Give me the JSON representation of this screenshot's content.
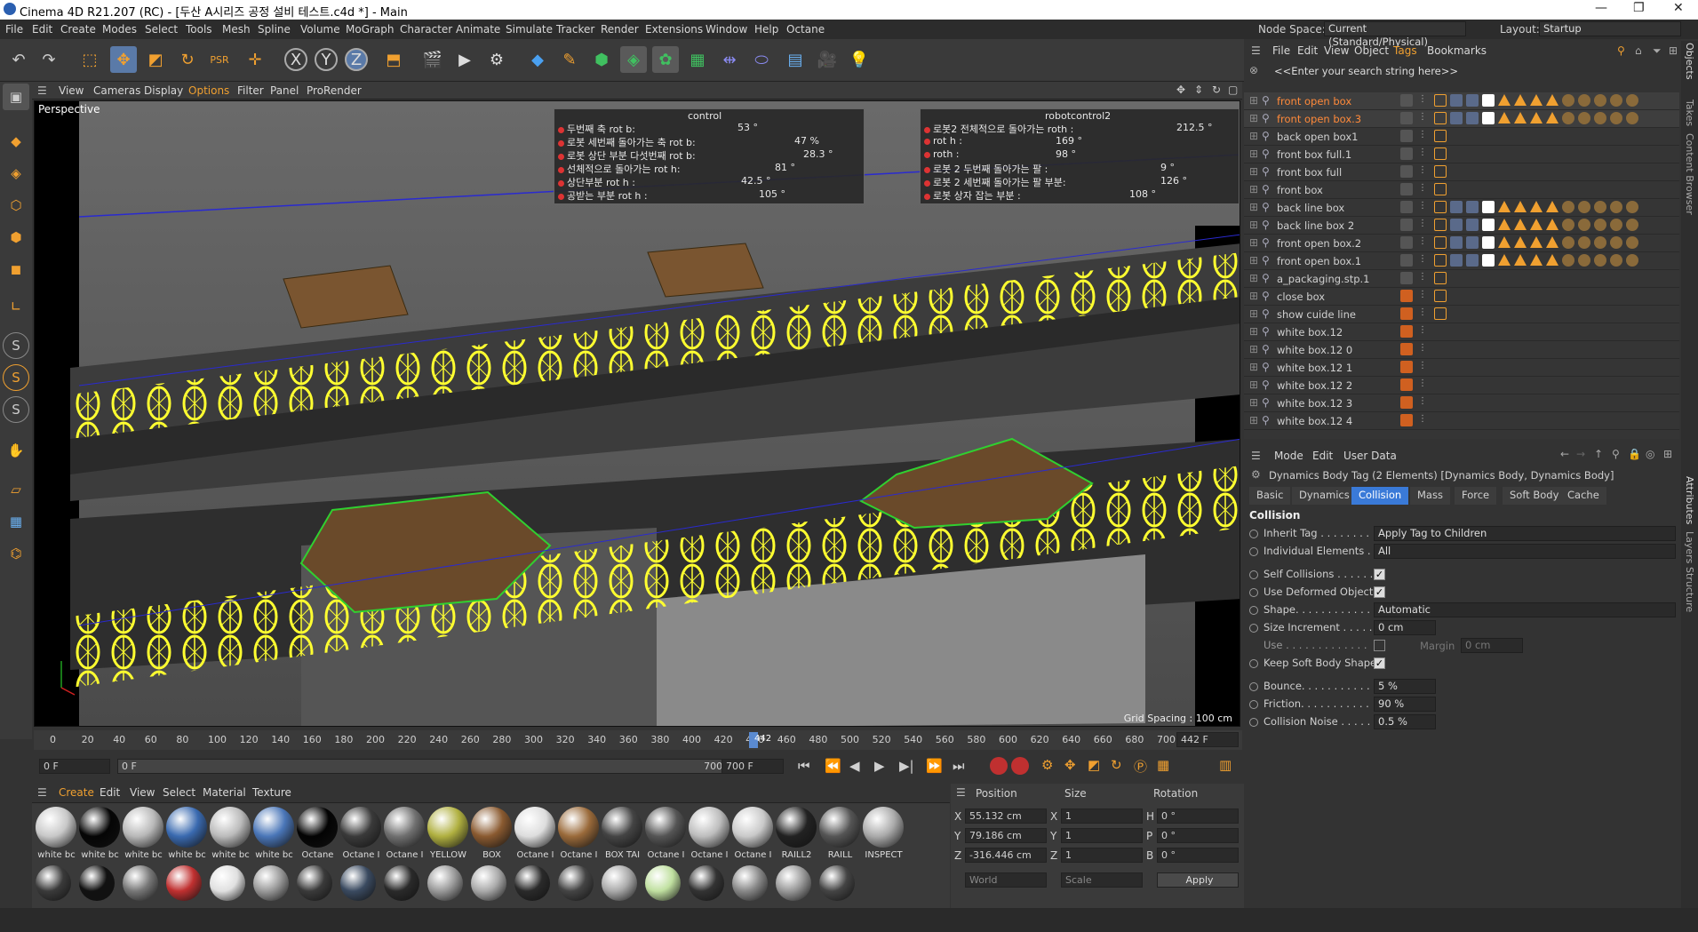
{
  "title": "Cinema 4D R21.207 (RC) - [두산 A시리즈 공정 설비 테스트.c4d *] - Main",
  "menu": [
    "File",
    "Edit",
    "Create",
    "Modes",
    "Select",
    "Tools",
    "Mesh",
    "Spline",
    "Volume",
    "MoGraph",
    "Character",
    "Animate",
    "Simulate",
    "Tracker",
    "Render",
    "Extensions",
    "Window",
    "Help",
    "Octane"
  ],
  "right_header": {
    "node_space_label": "Node Space:",
    "node_space_value": "Current (Standard/Physical)",
    "layout_label": "Layout:",
    "layout_value": "Startup"
  },
  "viewport": {
    "menu": [
      "View",
      "Cameras",
      "Display",
      "Options",
      "Filter",
      "Panel",
      "ProRender"
    ],
    "label": "Perspective",
    "grid_spacing": "Grid Spacing : 100 cm"
  },
  "control_panel": {
    "title": "control",
    "rows": [
      {
        "label": "두번째 축 rot b:",
        "value": "53 °"
      },
      {
        "label": "로봇 세번째 돌아가는 축  rot b:",
        "value": "47 %"
      },
      {
        "label": "로봇 상단 부분 다섯번째 rot b:",
        "value": "28.3 °"
      },
      {
        "label": "선체적으로 돌아가는 rot h:",
        "value": "81 °"
      },
      {
        "label": "상단부분  rot h :",
        "value": "42.5 °"
      },
      {
        "label": "공받는 부분  rot h :",
        "value": "105 °"
      }
    ]
  },
  "robot_panel": {
    "title": "robotcontrol2",
    "rows": [
      {
        "label": "로봇2 전체적으로 돌아가는 roth :",
        "value": "212.5 °"
      },
      {
        "label": "rot h :",
        "value": "169 °"
      },
      {
        "label": "roth :",
        "value": "98 °"
      },
      {
        "label": "로봇 2 두번째 돌아가는 팔 :",
        "value": "9 °"
      },
      {
        "label": "로봇 2 세번째 돌아가는 팔 부분:",
        "value": "126 °"
      },
      {
        "label": "로봇 상자 잡는 부분 :",
        "value": "108 °"
      }
    ]
  },
  "timeline": {
    "ticks": [
      "0",
      "20",
      "40",
      "60",
      "80",
      "100",
      "120",
      "140",
      "160",
      "180",
      "200",
      "220",
      "240",
      "260",
      "280",
      "300",
      "320",
      "340",
      "360",
      "380",
      "400",
      "420",
      "440",
      "460",
      "480",
      "500",
      "520",
      "540",
      "560",
      "580",
      "600",
      "620",
      "640",
      "660",
      "680",
      "700"
    ],
    "current_frame_marker": "442",
    "current_field": "442 F",
    "start_field": "0 F",
    "range_start": "0 F",
    "range_end": "700 F",
    "end_field": "700 F"
  },
  "material_menu": [
    "Create",
    "Edit",
    "View",
    "Select",
    "Material",
    "Texture"
  ],
  "materials": [
    {
      "label": "white bc",
      "color": "#c8c8c8"
    },
    {
      "label": "white bc",
      "color": "#050505"
    },
    {
      "label": "white bc",
      "color": "#b8b8b8"
    },
    {
      "label": "white bc",
      "color": "#3a6ab0"
    },
    {
      "label": "white bc",
      "color": "#bbbbbb"
    },
    {
      "label": "white bc",
      "color": "#4a76b8"
    },
    {
      "label": "Octane",
      "color": "#030303"
    },
    {
      "label": "Octane I",
      "color": "#3a3a3a"
    },
    {
      "label": "Octane I",
      "color": "#707070"
    },
    {
      "label": "YELLOW",
      "color": "#b0b040"
    },
    {
      "label": "BOX",
      "color": "#8a5a30"
    },
    {
      "label": "Octane I",
      "color": "#dddddd"
    },
    {
      "label": "Octane I",
      "color": "#9a6a3a"
    },
    {
      "label": "BOX TAI",
      "color": "#444444"
    },
    {
      "label": "Octane I",
      "color": "#555555"
    },
    {
      "label": "Octane I",
      "color": "#bdbdbd"
    },
    {
      "label": "Octane I",
      "color": "#c9c9c9"
    },
    {
      "label": "RAILL2",
      "color": "#222222"
    },
    {
      "label": "RAILL",
      "color": "#555555"
    },
    {
      "label": "INSPECT",
      "color": "#aaaaaa"
    }
  ],
  "materials_row2": [
    "#3a3a3a",
    "#111111",
    "#777777",
    "#c03030",
    "#e0e0e0",
    "#9a9a9a",
    "#3a3a3a",
    "#3a4a60",
    "#2a2a2a",
    "#999999",
    "#aaaaaa",
    "#2a2a2a",
    "#444444",
    "#aaaaaa",
    "#c0e0a0",
    "#333333",
    "#888888",
    "#999999",
    "#444444"
  ],
  "coords": {
    "headers": [
      "Position",
      "Size",
      "Rotation"
    ],
    "rows": [
      {
        "axis": "X",
        "pos": "55.132 cm",
        "saxis": "X",
        "size": "1",
        "raxis": "H",
        "rot": "0 °"
      },
      {
        "axis": "Y",
        "pos": "79.186 cm",
        "saxis": "Y",
        "size": "1",
        "raxis": "P",
        "rot": "0 °"
      },
      {
        "axis": "Z",
        "pos": "-316.446 cm",
        "saxis": "Z",
        "size": "1",
        "raxis": "B",
        "rot": "0 °"
      }
    ],
    "space": "World",
    "scale": "Scale",
    "apply": "Apply"
  },
  "objects_menu": [
    "File",
    "Edit",
    "View",
    "Object",
    "Tags",
    "Bookmarks"
  ],
  "search_placeholder": "<<Enter your search string here>>",
  "objects": [
    {
      "name": "front open box",
      "color": "#ff8a3a",
      "tags": true
    },
    {
      "name": "front open box.3",
      "color": "#ff8a3a",
      "tags": true
    },
    {
      "name": "back open box1",
      "color": "#d0d0d0",
      "tags": false
    },
    {
      "name": "front box full.1",
      "color": "#d0d0d0",
      "tags": false
    },
    {
      "name": "front box full",
      "color": "#d0d0d0",
      "tags": false
    },
    {
      "name": "front box",
      "color": "#d0d0d0",
      "tags": false
    },
    {
      "name": "back line box",
      "color": "#d0d0d0",
      "tags": true
    },
    {
      "name": "back line box 2",
      "color": "#d0d0d0",
      "tags": true
    },
    {
      "name": "front open box.2",
      "color": "#d0d0d0",
      "tags": true
    },
    {
      "name": "front open box.1",
      "color": "#d0d0d0",
      "tags": true
    },
    {
      "name": "a_packaging.stp.1",
      "color": "#d0d0d0",
      "tags": false
    },
    {
      "name": "close box",
      "color": "#d0d0d0",
      "tags": false
    },
    {
      "name": "show cuide line",
      "color": "#d0d0d0",
      "tags": false
    },
    {
      "name": "white box.12",
      "color": "#d0d0d0",
      "tags": false
    },
    {
      "name": "white box.12 0",
      "color": "#d0d0d0",
      "tags": false
    },
    {
      "name": "white box.12 1",
      "color": "#d0d0d0",
      "tags": false
    },
    {
      "name": "white box.12 2",
      "color": "#d0d0d0",
      "tags": false
    },
    {
      "name": "white box.12 3",
      "color": "#d0d0d0",
      "tags": false
    },
    {
      "name": "white box.12 4",
      "color": "#d0d0d0",
      "tags": false
    }
  ],
  "attributes": {
    "menu": [
      "Mode",
      "Edit",
      "User Data"
    ],
    "title": "Dynamics Body Tag (2 Elements) [Dynamics Body, Dynamics Body]",
    "tabs": [
      "Basic",
      "Dynamics",
      "Collision",
      "Mass",
      "Force",
      "Soft Body",
      "Cache"
    ],
    "active_tab": "Collision",
    "section": "Collision",
    "inherit_tag": {
      "label": "Inherit Tag . . . . . . . .",
      "value": "Apply Tag to Children"
    },
    "individual": {
      "label": "Individual Elements . .",
      "value": "All"
    },
    "self_collisions": "Self Collisions . . . . . .",
    "use_deformed": "Use Deformed Object",
    "shape": {
      "label": "Shape. . . . . . . . . . . .",
      "value": "Automatic"
    },
    "size_increment": {
      "label": "Size Increment . . . . .",
      "value": "0 cm"
    },
    "use": {
      "label": "Use . . . . . . . . . . . . .",
      "margin_label": "Margin",
      "margin_value": "0 cm"
    },
    "keep_soft": "Keep Soft Body Shape",
    "bounce": {
      "label": "Bounce. . . . . . . . . . .",
      "value": "5 %"
    },
    "friction": {
      "label": "Friction. . . . . . . . . . .",
      "value": "90 %"
    },
    "noise": {
      "label": "Collision Noise . . . . .",
      "value": "0.5 %"
    }
  },
  "side_tabs": [
    "Objects",
    "Takes",
    "Content Browser"
  ],
  "side_tabs2": [
    "Attributes",
    "Layers",
    "Structure"
  ],
  "accent": "#3a7ad8",
  "selected_orange": "#ff8a3a"
}
